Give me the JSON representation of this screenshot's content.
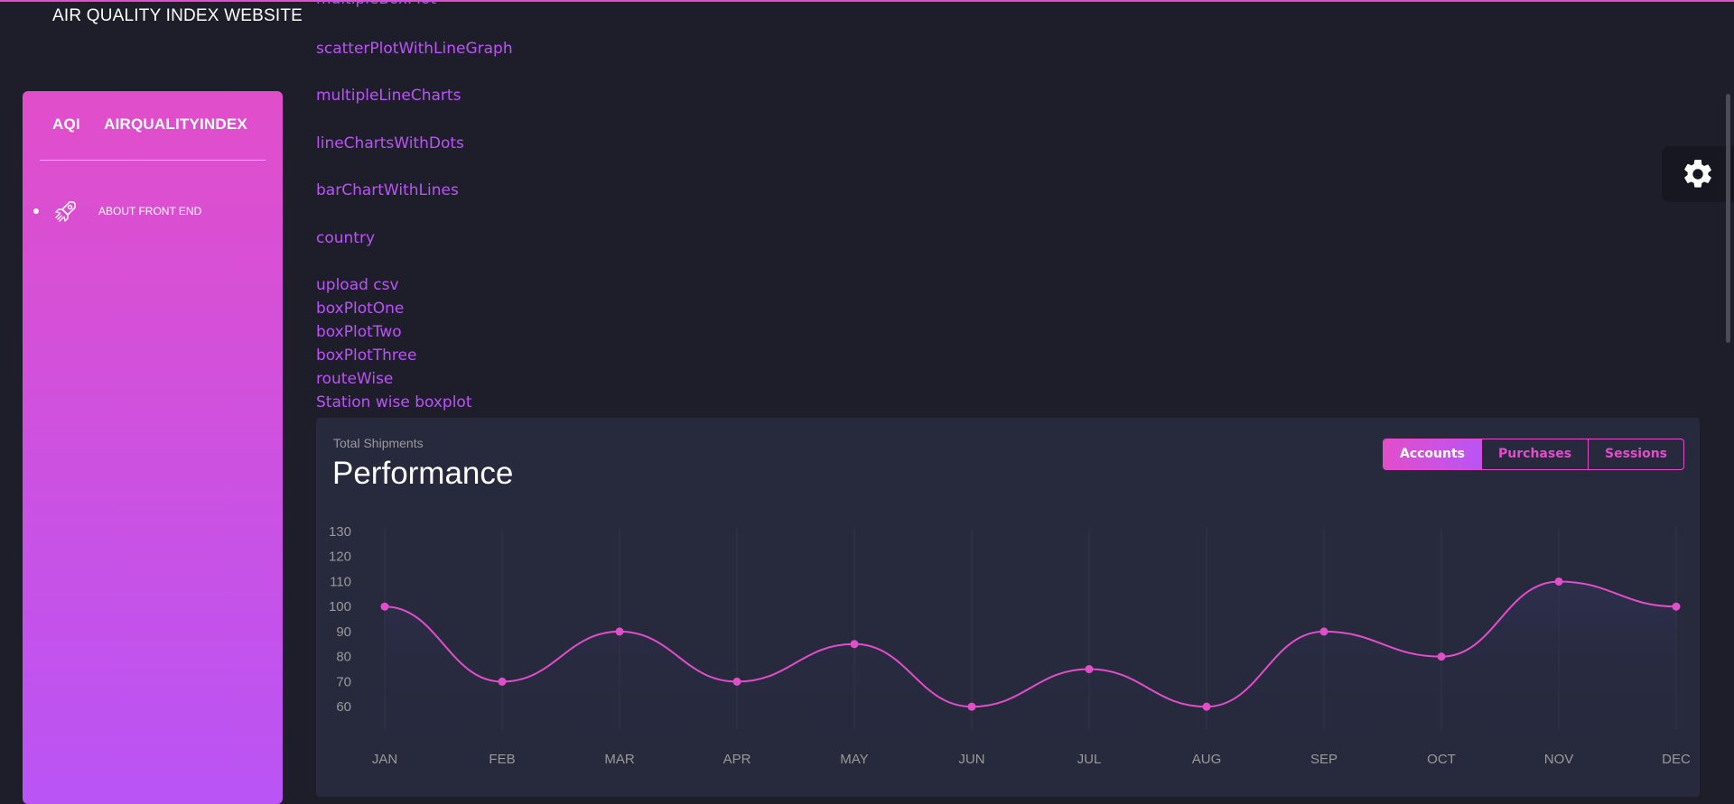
{
  "brand": {
    "title": "AIR QUALITY INDEX WEBSITE"
  },
  "sidebar": {
    "logo_mini": "AQI",
    "logo_normal": "AIRQUALITYINDEX",
    "items": [
      {
        "label": "ABOUT FRONT END",
        "icon": "rocket-icon"
      }
    ]
  },
  "links": [
    "multipleBoxPlot",
    "scatterPlotWithLineGraph",
    "multipleLineCharts",
    "lineChartsWithDots",
    "barChartWithLines",
    "country",
    "upload csv",
    "boxPlotOne",
    "boxPlotTwo",
    "boxPlotThree",
    "routeWise",
    "Station wise boxplot"
  ],
  "settings": {
    "icon": "gear-icon"
  },
  "card": {
    "category": "Total Shipments",
    "title": "Performance",
    "buttons": [
      {
        "label": "Accounts",
        "active": true
      },
      {
        "label": "Purchases",
        "active": false
      },
      {
        "label": "Sessions",
        "active": false
      }
    ]
  },
  "colors": {
    "accent": "#e14eca",
    "accent2": "#ba54f5",
    "background": "#1e1e2b",
    "card": "#27293d"
  },
  "chart_data": {
    "type": "line",
    "categories": [
      "JAN",
      "FEB",
      "MAR",
      "APR",
      "MAY",
      "JUN",
      "JUL",
      "AUG",
      "SEP",
      "OCT",
      "NOV",
      "DEC"
    ],
    "series": [
      {
        "values": [
          100,
          70,
          90,
          70,
          85,
          60,
          75,
          60,
          90,
          80,
          110,
          100
        ]
      }
    ],
    "y_ticks": [
      60,
      70,
      80,
      90,
      100,
      110,
      120,
      130
    ],
    "ylim": [
      55,
      130
    ],
    "grid": "vertical",
    "legend": "none",
    "title": "",
    "xlabel": "",
    "ylabel": "",
    "line_color": "#e14eca"
  }
}
